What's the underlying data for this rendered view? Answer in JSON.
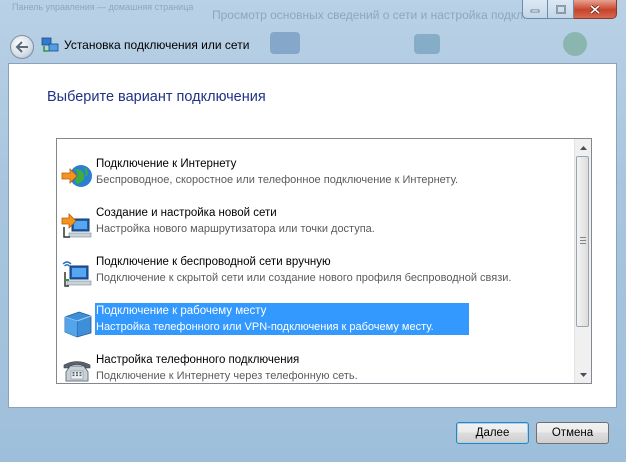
{
  "window": {
    "title": "Установка подключения или сети",
    "heading": "Выберите вариант подключения"
  },
  "background_window": {
    "title": "Просмотр основных сведений о сети и настройка подключений",
    "left_text": "Панель управления — домашняя страница"
  },
  "options": [
    {
      "icon": "globe-network-icon",
      "title": "Подключение к Интернету",
      "description": "Беспроводное, скоростное или телефонное подключение к Интернету.",
      "selected": false
    },
    {
      "icon": "new-network-icon",
      "title": "Создание и настройка новой сети",
      "description": "Настройка нового маршрутизатора или точки доступа.",
      "selected": false
    },
    {
      "icon": "wireless-network-icon",
      "title": "Подключение к беспроводной сети вручную",
      "description": "Подключение к скрытой сети или создание нового профиля беспроводной связи.",
      "selected": false
    },
    {
      "icon": "workplace-icon",
      "title": "Подключение к рабочему месту",
      "description": "Настройка телефонного или VPN-подключения к рабочему месту.",
      "selected": true
    },
    {
      "icon": "telephone-icon",
      "title": "Настройка телефонного подключения",
      "description": "Подключение к Интернету через телефонную сеть.",
      "selected": false
    }
  ],
  "buttons": {
    "next": "Далее",
    "cancel": "Отмена"
  },
  "colors": {
    "heading": "#1e3287",
    "selection": "#3399ff"
  }
}
